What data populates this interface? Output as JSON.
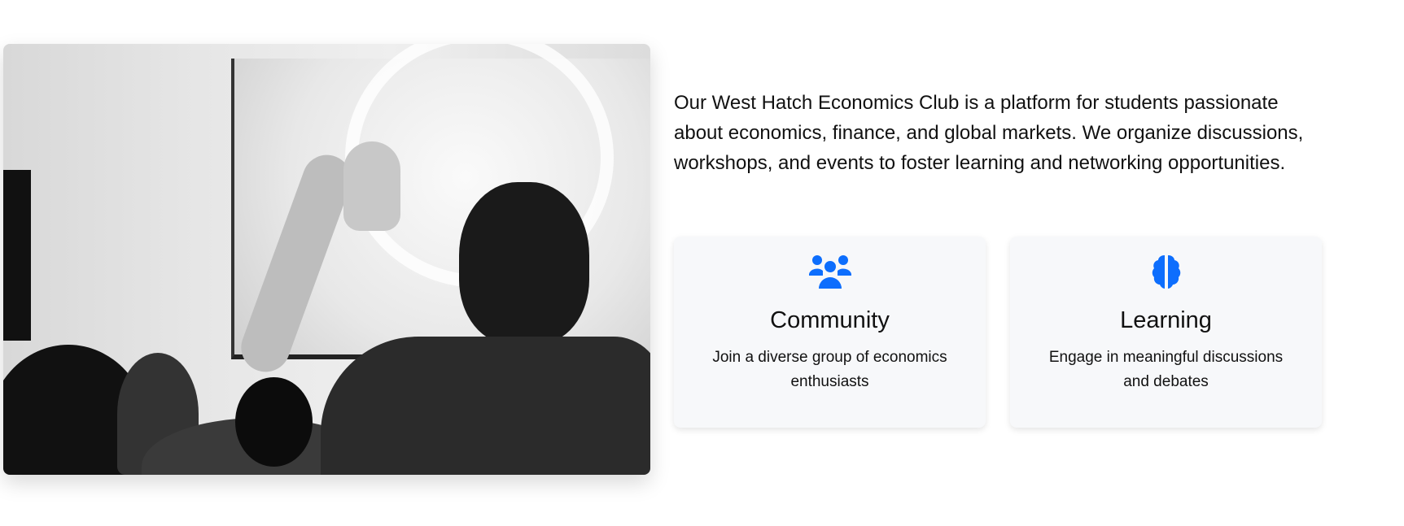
{
  "about": {
    "text": "Our West Hatch Economics Club is a platform for students passionate about economics, finance, and global markets. We organize discussions, workshops, and events to foster learning and networking opportunities."
  },
  "features": [
    {
      "icon": "users-icon",
      "title": "Community",
      "description": "Join a diverse group of economics enthusiasts"
    },
    {
      "icon": "brain-icon",
      "title": "Learning",
      "description": "Engage in meaningful discussions and debates"
    }
  ],
  "colors": {
    "accent": "#0d6efd",
    "card_bg": "#f7f8fa"
  }
}
